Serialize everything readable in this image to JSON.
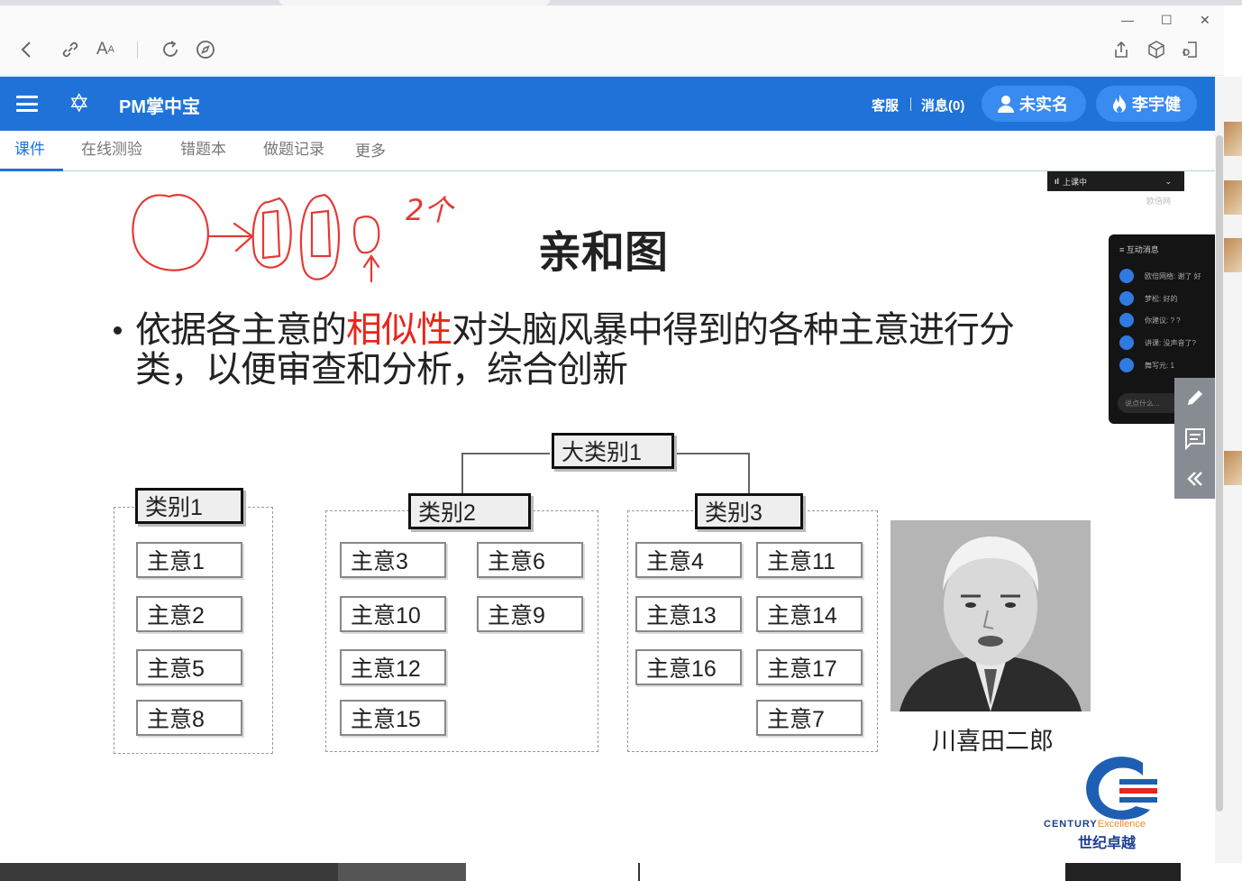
{
  "app": {
    "brand": "PM掌中宝",
    "service_label": "客服",
    "messages_label": "消息(0)",
    "realname_label": "未实名",
    "user_label": "李宇健",
    "colors": {
      "header": "#1f72d8",
      "pill": "#3a8bf0",
      "highlight": "#e8261b"
    }
  },
  "browser": {
    "window_controls": [
      "—",
      "☐",
      "✕"
    ]
  },
  "tabs": [
    {
      "label": "课件",
      "active": true
    },
    {
      "label": "在线测验",
      "active": false
    },
    {
      "label": "错题本",
      "active": false
    },
    {
      "label": "做题记录",
      "active": false
    },
    {
      "label": "更多",
      "active": false
    }
  ],
  "slide": {
    "title": "亲和图",
    "annotation": "2个",
    "bullet_pre": "依据各主意的",
    "bullet_highlight": "相似性",
    "bullet_post": "对头脑风暴中得到的各种主意进行分类，以便审查和分析，综合创新",
    "top_category": "大类别1",
    "groups": [
      {
        "label": "类别1",
        "ideas": [
          "主意1",
          "主意2",
          "主意5",
          "主意8"
        ]
      },
      {
        "label": "类别2",
        "ideas": [
          "主意3",
          "主意6",
          "主意10",
          "主意9",
          "主意12",
          "主意15"
        ]
      },
      {
        "label": "类别3",
        "ideas": [
          "主意4",
          "主意11",
          "主意13",
          "主意14",
          "主意16",
          "主意17",
          "主意7"
        ]
      }
    ],
    "photo_caption": "川喜田二郎",
    "logo_en_main": "CENTURY",
    "logo_en_sub": "Excellence",
    "logo_cn": "世纪卓越"
  },
  "live": {
    "bar_label": "上课中",
    "watermark": "欧倍网",
    "chat_title": "互动消息",
    "chat_messages": [
      "欧倍网络: 谢了 好",
      "梦松: 好的",
      "你建议: ? ?",
      "讲课: 没声音了?",
      "舞写元: 1"
    ],
    "chat_placeholder": "说点什么..."
  },
  "icons": {
    "back": "back-icon",
    "link": "link-icon",
    "read-aloud": "read-aloud-icon",
    "refresh": "refresh-icon",
    "compass": "compass-icon",
    "share": "share-icon",
    "cube": "cube-icon",
    "extension": "extension-icon",
    "menu": "hamburger-icon",
    "brand": "star-logo-icon",
    "user": "user-icon",
    "fire": "fire-icon",
    "edit": "pencil-icon",
    "chat": "chat-icon",
    "collapse": "double-chevron-left-icon"
  }
}
